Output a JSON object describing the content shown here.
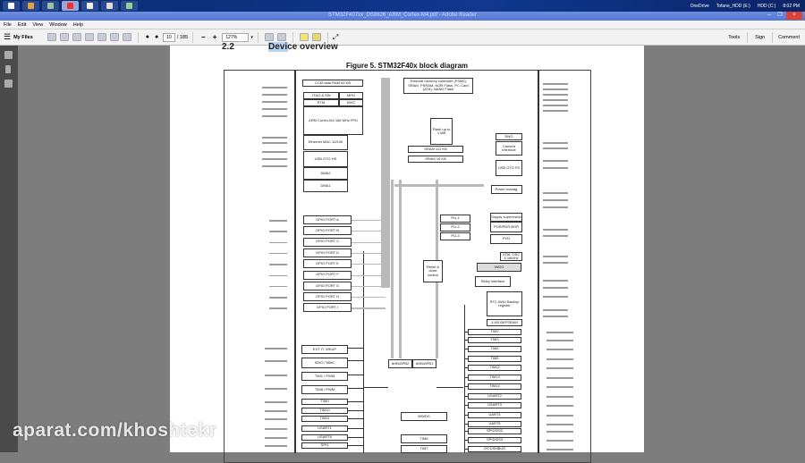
{
  "taskbar": {
    "tray": [
      "OneDrive",
      "Tofane_HDD (E:)",
      "HDD (C:)"
    ],
    "clock": "8:02 PM",
    "apps": [
      "windows-start",
      "chrome",
      "explorer",
      "adobe-reader",
      "app-4",
      "app-5",
      "app-6"
    ]
  },
  "window": {
    "title": "STM32F407xx_DS8626_ARM_Cortex-M4.pdf - Adobe Reader",
    "close": "×",
    "minimize": "–",
    "maximize": "❐"
  },
  "menu": [
    "File",
    "Edit",
    "View",
    "Window",
    "Help"
  ],
  "toolbar": {
    "my_files": "My Files",
    "page_current": "10",
    "page_total": "/ 185",
    "zoom": "127%",
    "tools": "Tools",
    "sign": "Sign",
    "comment": "Comment"
  },
  "doc": {
    "section_number": "2.2",
    "section_title": "Device overview",
    "figure_title": "Figure 5. STM32F40x block diagram",
    "blocks": [
      "CCM data RAM 64 KB",
      "JTAG & SW",
      "MPU",
      "ETM",
      "NVIC",
      "ARM Cortex-M4 168 MHz FPU",
      "Ethernet MAC 10/100",
      "USB OTG HS",
      "DMA2",
      "DMA1",
      "External memory controller (FSMC) SRAM, PSRAM, NOR Flash, PC Card (ATA), NAND Flash",
      "Flash up to 1 MB",
      "SRAM 112 KB",
      "SRAM 16 KB",
      "RNG",
      "Camera interface",
      "USB OTG FS",
      "Power manag.",
      "Supply supervision",
      "POR/PDR BOR",
      "PVD",
      "XTAL OSC 4-16MHz",
      "IWDG",
      "Stdby interface",
      "RTC AWU Backup register",
      "4 KB BKPSRAM",
      "PLL1",
      "PLL2",
      "PLL3",
      "Reset & clock control",
      "AHB/APB2",
      "AHB/APB1",
      "WWDG",
      "TIM6",
      "TIM7"
    ],
    "gpio": [
      "GPIO PORT A",
      "GPIO PORT B",
      "GPIO PORT C",
      "GPIO PORT D",
      "GPIO PORT E",
      "GPIO PORT F",
      "GPIO PORT G",
      "GPIO PORT H",
      "GPIO PORT I"
    ],
    "apb2": [
      "EXT IT. WKUP",
      "SDIO / MMC",
      "TIM1 / PWM",
      "TIM8 / PWM",
      "TIM9",
      "TIM10",
      "TIM11",
      "USART1",
      "USART6",
      "SPI1"
    ],
    "apb1": [
      "TIM2",
      "TIM3",
      "TIM4",
      "TIM5",
      "TIM12",
      "TIM13",
      "TIM14",
      "USART2",
      "USART3",
      "UART4",
      "UART5",
      "SPI2/I2S2",
      "SPI3/I2S3",
      "I2C1/SMBUS"
    ]
  },
  "watermark": "aparat.com/khoshtekr"
}
